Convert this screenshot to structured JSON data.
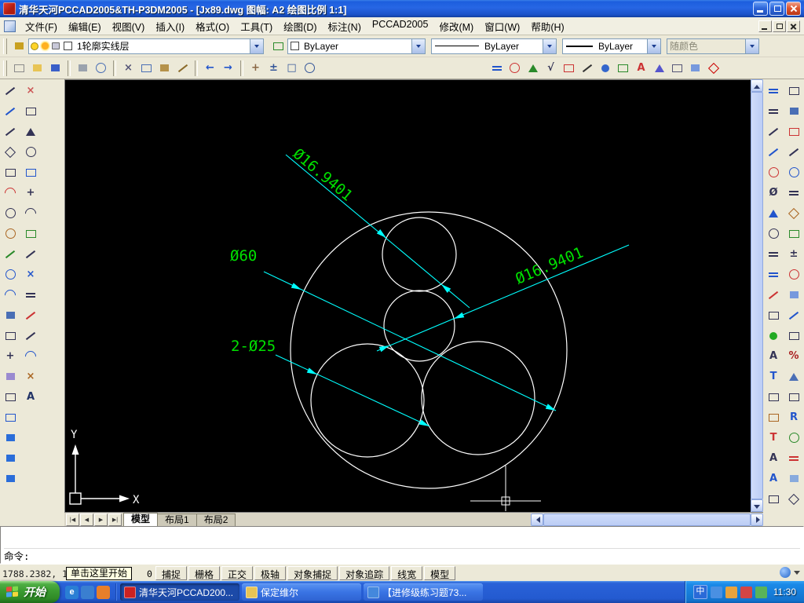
{
  "window": {
    "title": "清华天河PCCAD2005&TH-P3DM2005 - [Jx89.dwg 图幅: A2 绘图比例 1:1]"
  },
  "menu_bar": {
    "items": [
      {
        "id": "file",
        "label": "文件(F)"
      },
      {
        "id": "edit",
        "label": "编辑(E)"
      },
      {
        "id": "view",
        "label": "视图(V)"
      },
      {
        "id": "insert",
        "label": "插入(I)"
      },
      {
        "id": "format",
        "label": "格式(O)"
      },
      {
        "id": "tools",
        "label": "工具(T)"
      },
      {
        "id": "draw",
        "label": "绘图(D)"
      },
      {
        "id": "dimension",
        "label": "标注(N)"
      },
      {
        "id": "pccad2005",
        "label": "PCCAD2005"
      },
      {
        "id": "modify",
        "label": "修改(M)"
      },
      {
        "id": "window",
        "label": "窗口(W)"
      },
      {
        "id": "help",
        "label": "帮助(H)"
      }
    ]
  },
  "toolbar_properties": {
    "layer": {
      "value": "1轮廓实线层"
    },
    "color": {
      "value": "ByLayer"
    },
    "linetype": {
      "value": "ByLayer"
    },
    "lineweight": {
      "value": "ByLayer"
    },
    "plot_style": {
      "value": "随颜色"
    }
  },
  "toolbar_standard": {
    "icons": [
      {
        "name": "new-file",
        "shape": "rect",
        "color": "#8a8a8a"
      },
      {
        "name": "open-file",
        "shape": "frect",
        "color": "#e8c455"
      },
      {
        "name": "save-file",
        "shape": "frect",
        "color": "#3a5fc8"
      },
      {
        "sep": true
      },
      {
        "name": "plot",
        "shape": "frect",
        "color": "#9aa2ad"
      },
      {
        "name": "plot-preview",
        "shape": "circle",
        "color": "#4a6fb5"
      },
      {
        "sep": true
      },
      {
        "name": "cut",
        "shape": "glyph",
        "glyph": "×",
        "color": "#555577"
      },
      {
        "name": "copy-clip",
        "shape": "rect",
        "color": "#4a6fb5"
      },
      {
        "name": "paste-clip",
        "shape": "frect",
        "color": "#b5924a"
      },
      {
        "name": "match-properties",
        "shape": "line",
        "color": "#8a6a2a"
      },
      {
        "sep": true
      },
      {
        "name": "undo",
        "shape": "glyph",
        "glyph": "←",
        "color": "#2255cc"
      },
      {
        "name": "redo",
        "shape": "glyph",
        "glyph": "→",
        "color": "#2255cc"
      },
      {
        "sep": true
      },
      {
        "name": "pan",
        "shape": "glyph",
        "glyph": "+",
        "color": "#886644"
      },
      {
        "name": "zoom-realtime",
        "shape": "glyph",
        "glyph": "±",
        "color": "#335599"
      },
      {
        "name": "zoom-window",
        "shape": "glyph",
        "glyph": "□",
        "color": "#335599"
      },
      {
        "name": "zoom-previous",
        "shape": "circle",
        "color": "#335599"
      }
    ]
  },
  "toolbar_pccad": {
    "icons": [
      {
        "name": "dim-linear",
        "shape": "hline",
        "color": "#2255cc"
      },
      {
        "name": "dim-radial",
        "shape": "circle",
        "color": "#cc3333"
      },
      {
        "name": "dim-angular",
        "shape": "tri",
        "color": "#2a8a2a"
      },
      {
        "name": "surface-roughness",
        "shape": "glyph",
        "glyph": "√",
        "color": "#333355"
      },
      {
        "name": "datum-symbol",
        "shape": "rect",
        "color": "#cc3333"
      },
      {
        "name": "section-symbol",
        "shape": "line",
        "color": "#333333"
      },
      {
        "name": "balloon",
        "shape": "fcircle",
        "color": "#3366cc"
      },
      {
        "name": "bom-table",
        "shape": "rect",
        "color": "#2a8a2a"
      },
      {
        "name": "text-annotation",
        "shape": "glyph",
        "glyph": "A",
        "color": "#cc3333"
      },
      {
        "name": "weld-symbol",
        "shape": "tri",
        "color": "#5555cc"
      },
      {
        "name": "tolerance",
        "shape": "rect",
        "color": "#555577"
      },
      {
        "name": "title-block",
        "shape": "frect",
        "color": "#7799dd"
      },
      {
        "name": "symbol-library",
        "shape": "diamond",
        "color": "#cc0000"
      }
    ]
  },
  "left_toolbar": {
    "col1": [
      {
        "name": "draw-line",
        "shape": "line",
        "color": "#333355"
      },
      {
        "name": "construction-line",
        "shape": "line",
        "color": "#2255cc"
      },
      {
        "name": "polyline",
        "shape": "line",
        "color": "#333355"
      },
      {
        "name": "polygon",
        "shape": "diamond",
        "color": "#333355"
      },
      {
        "name": "rectangle",
        "shape": "rect",
        "color": "#333355"
      },
      {
        "name": "arc",
        "shape": "arc",
        "color": "#cc3333"
      },
      {
        "name": "circle",
        "shape": "circle",
        "color": "#333355"
      },
      {
        "name": "revision-cloud",
        "shape": "circle",
        "color": "#aa6622"
      },
      {
        "name": "spline",
        "shape": "line",
        "color": "#2a8a2a"
      },
      {
        "name": "ellipse",
        "shape": "circle",
        "color": "#2255cc"
      },
      {
        "name": "ellipse-arc",
        "shape": "arc",
        "color": "#2255cc"
      },
      {
        "name": "insert-block",
        "shape": "frect",
        "color": "#4a6fb5"
      },
      {
        "name": "make-block",
        "shape": "rect",
        "color": "#333355"
      },
      {
        "name": "point",
        "shape": "glyph",
        "glyph": "+",
        "color": "#333355"
      },
      {
        "name": "hatch",
        "shape": "frect",
        "color": "#9a8ad0"
      },
      {
        "name": "region",
        "shape": "rect",
        "color": "#333355"
      },
      {
        "name": "table",
        "shape": "rect",
        "color": "#2255cc"
      },
      {
        "name": "pccad-library",
        "shape": "frect",
        "color": "#2a6dd9"
      },
      {
        "name": "pccad-browser",
        "shape": "frect",
        "color": "#2a6dd9"
      },
      {
        "name": "pccad-assistant",
        "shape": "frect",
        "color": "#2a6dd9"
      }
    ],
    "col2": [
      {
        "name": "erase",
        "shape": "glyph",
        "glyph": "×",
        "color": "#cc5555"
      },
      {
        "name": "copy-object",
        "shape": "rect",
        "color": "#333355"
      },
      {
        "name": "mirror",
        "shape": "tri",
        "color": "#333355"
      },
      {
        "name": "offset",
        "shape": "circle",
        "color": "#333355"
      },
      {
        "name": "array",
        "shape": "rect",
        "color": "#2255cc"
      },
      {
        "name": "move",
        "shape": "glyph",
        "glyph": "+",
        "color": "#333355"
      },
      {
        "name": "rotate",
        "shape": "arc",
        "color": "#333355"
      },
      {
        "name": "scale",
        "shape": "rect",
        "color": "#2a8a2a"
      },
      {
        "name": "stretch",
        "shape": "line",
        "color": "#333355"
      },
      {
        "name": "trim",
        "shape": "glyph",
        "glyph": "×",
        "color": "#2255cc"
      },
      {
        "name": "extend",
        "shape": "hline",
        "color": "#333355"
      },
      {
        "name": "break",
        "shape": "line",
        "color": "#cc3333"
      },
      {
        "name": "chamfer",
        "shape": "line",
        "color": "#333355"
      },
      {
        "name": "fillet",
        "shape": "arc",
        "color": "#2255cc"
      },
      {
        "name": "explode",
        "shape": "glyph",
        "glyph": "×",
        "color": "#aa6622"
      },
      {
        "name": "text",
        "shape": "glyph",
        "glyph": "A",
        "color": "#223366"
      }
    ]
  },
  "right_toolbar": {
    "col1": [
      {
        "name": "quick-dimension",
        "shape": "hline",
        "color": "#2255cc"
      },
      {
        "name": "linear-dimension",
        "shape": "hline",
        "color": "#333355"
      },
      {
        "name": "aligned-dimension",
        "shape": "line",
        "color": "#333355"
      },
      {
        "name": "ordinate-dimension",
        "shape": "line",
        "color": "#2255cc"
      },
      {
        "name": "radius-dimension",
        "shape": "circle",
        "color": "#cc3333"
      },
      {
        "name": "diameter-dimension",
        "shape": "glyph",
        "glyph": "Ø",
        "color": "#333355"
      },
      {
        "name": "angular-dimension",
        "shape": "tri",
        "color": "#2255cc"
      },
      {
        "name": "arc-length-dimension",
        "shape": "circle",
        "color": "#333355"
      },
      {
        "name": "baseline-dimension",
        "shape": "hline",
        "color": "#333355"
      },
      {
        "name": "continue-dimension",
        "shape": "hline",
        "color": "#2255cc"
      },
      {
        "name": "quick-leader",
        "shape": "line",
        "color": "#cc3333"
      },
      {
        "name": "tolerance-dimension",
        "shape": "rect",
        "color": "#333355"
      },
      {
        "name": "center-mark",
        "shape": "fcircle",
        "color": "#22aa22"
      },
      {
        "name": "dimension-edit",
        "shape": "glyph",
        "glyph": "A",
        "color": "#333355"
      },
      {
        "name": "dimension-text-edit",
        "shape": "glyph",
        "glyph": "T",
        "color": "#2255cc"
      },
      {
        "name": "dimension-update",
        "shape": "rect",
        "color": "#333355"
      },
      {
        "name": "dimension-style",
        "shape": "rect",
        "color": "#aa6622"
      },
      {
        "name": "text-style",
        "shape": "glyph",
        "glyph": "T",
        "color": "#cc3333"
      },
      {
        "name": "single-line-text",
        "shape": "glyph",
        "glyph": "A",
        "color": "#333355"
      },
      {
        "name": "multiline-text",
        "shape": "glyph",
        "glyph": "A",
        "color": "#2255cc"
      },
      {
        "name": "insert-table",
        "shape": "rect",
        "color": "#333355"
      }
    ],
    "col2": [
      {
        "name": "draw-order",
        "shape": "rect",
        "color": "#333355"
      },
      {
        "name": "pccad-tool-1",
        "shape": "frect",
        "color": "#4a6fb5"
      },
      {
        "name": "pccad-tool-2",
        "shape": "rect",
        "color": "#cc3333"
      },
      {
        "name": "pccad-tool-3",
        "shape": "line",
        "color": "#333355"
      },
      {
        "name": "pccad-tool-4",
        "shape": "circle",
        "color": "#2255cc"
      },
      {
        "name": "pccad-tool-5",
        "shape": "hline",
        "color": "#333355"
      },
      {
        "name": "pccad-tool-6",
        "shape": "diamond",
        "color": "#aa6622"
      },
      {
        "name": "pccad-tool-7",
        "shape": "rect",
        "color": "#2a8a2a"
      },
      {
        "name": "pccad-tool-8",
        "shape": "glyph",
        "glyph": "±",
        "color": "#333355"
      },
      {
        "name": "pccad-tool-9",
        "shape": "circle",
        "color": "#cc3333"
      },
      {
        "name": "pccad-tool-10",
        "shape": "frect",
        "color": "#7799dd"
      },
      {
        "name": "pccad-tool-11",
        "shape": "line",
        "color": "#2255cc"
      },
      {
        "name": "pccad-tool-12",
        "shape": "rect",
        "color": "#333355"
      },
      {
        "name": "pccad-tool-13",
        "shape": "glyph",
        "glyph": "%",
        "color": "#aa2222"
      },
      {
        "name": "pccad-tool-14",
        "shape": "tri",
        "color": "#4a6fb5"
      },
      {
        "name": "pccad-tool-15",
        "shape": "rect",
        "color": "#333355"
      },
      {
        "name": "pccad-tool-16",
        "shape": "glyph",
        "glyph": "R",
        "color": "#2255cc"
      },
      {
        "name": "pccad-tool-17",
        "shape": "circle",
        "color": "#2a8a2a"
      },
      {
        "name": "pccad-tool-18",
        "shape": "hline",
        "color": "#cc3333"
      },
      {
        "name": "pccad-tool-19",
        "shape": "frect",
        "color": "#88aadd"
      },
      {
        "name": "pccad-tool-20",
        "shape": "diamond",
        "color": "#333355"
      }
    ]
  },
  "drawing": {
    "dim_top": "Ø16.9401",
    "dim_right": "Ø16.9401",
    "dim_main": "Ø60",
    "dim_bottom": "2-Ø25",
    "ucs_x": "X",
    "ucs_y": "Y",
    "colors": {
      "background": "#000000",
      "entity": "#ffffff",
      "dimension_line": "#00ffff",
      "dimension_text": "#00e000"
    }
  },
  "tab_bar": {
    "nav": [
      "|◀",
      "◀",
      "▶",
      "▶|"
    ],
    "tabs": [
      {
        "id": "model",
        "label": "模型",
        "active": true
      },
      {
        "id": "layout1",
        "label": "布局1",
        "active": false
      },
      {
        "id": "layout2",
        "label": "布局2",
        "active": false
      }
    ]
  },
  "command_line": {
    "prompt": "命令:"
  },
  "status_bar": {
    "coords": "1788.2382, 14",
    "coords_tail": "0",
    "tooltip": "单击这里开始",
    "buttons": [
      {
        "id": "snap",
        "label": "捕捉",
        "pressed": false
      },
      {
        "id": "grid",
        "label": "栅格",
        "pressed": false
      },
      {
        "id": "ortho",
        "label": "正交",
        "pressed": false
      },
      {
        "id": "polar",
        "label": "极轴",
        "pressed": false
      },
      {
        "id": "osnap",
        "label": "对象捕捉",
        "pressed": false
      },
      {
        "id": "otrack",
        "label": "对象追踪",
        "pressed": false
      },
      {
        "id": "lineweight",
        "label": "线宽",
        "pressed": false
      },
      {
        "id": "model",
        "label": "模型",
        "pressed": false
      }
    ]
  },
  "taskbar": {
    "start": "开始",
    "quick_launch": [
      {
        "name": "internet-explorer",
        "glyph": "e",
        "color": "#2a7fd4"
      },
      {
        "name": "show-desktop",
        "glyph": "",
        "color": "#3a7fd0"
      },
      {
        "name": "media-player",
        "glyph": "",
        "color": "#e87f2a"
      }
    ],
    "tasks": [
      {
        "label": "清华天河PCCAD200...",
        "icon_color": "#cc2222",
        "active": true
      },
      {
        "label": "保定维尔",
        "icon_color": "#e8c455",
        "active": false
      },
      {
        "label": "【进修级练习题73...",
        "icon_color": "#4488dd",
        "active": false
      }
    ],
    "tray_icons": [
      {
        "name": "language-indicator",
        "glyph": "中"
      },
      {
        "name": "ime-keyboard",
        "color": "#4a90e2"
      },
      {
        "name": "antivirus",
        "color": "#e8a33d"
      },
      {
        "name": "messenger",
        "color": "#d24545"
      },
      {
        "name": "volume",
        "color": "#59b359"
      }
    ],
    "time": "11:30"
  }
}
